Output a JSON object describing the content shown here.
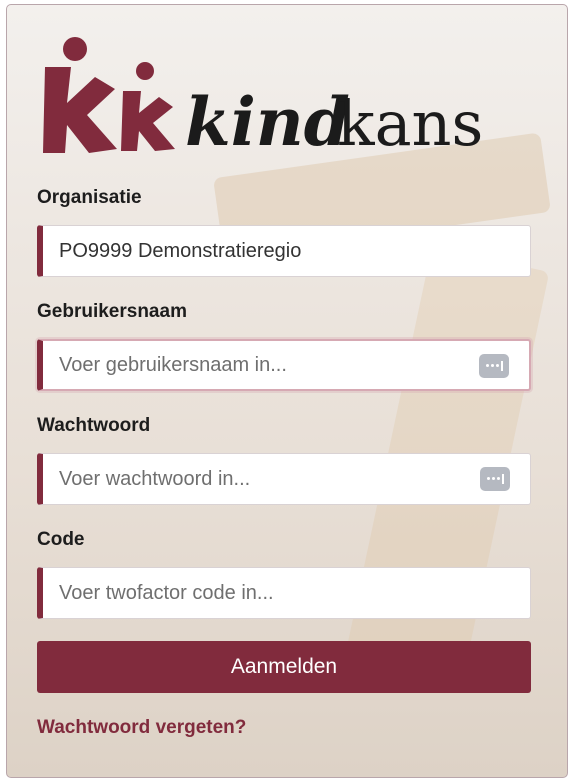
{
  "brand": {
    "logo_text_bold": "kind",
    "logo_text_light": "kans",
    "accent_color": "#812b3d"
  },
  "form": {
    "organisatie": {
      "label": "Organisatie",
      "value": "PO9999 Demonstratieregio"
    },
    "gebruikersnaam": {
      "label": "Gebruikersnaam",
      "placeholder": "Voer gebruikersnaam in...",
      "icon": "password-manager-icon"
    },
    "wachtwoord": {
      "label": "Wachtwoord",
      "placeholder": "Voer wachtwoord in...",
      "icon": "password-manager-icon"
    },
    "code": {
      "label": "Code",
      "placeholder": "Voer twofactor code in..."
    },
    "submit_label": "Aanmelden",
    "forgot_label": "Wachtwoord vergeten?"
  }
}
